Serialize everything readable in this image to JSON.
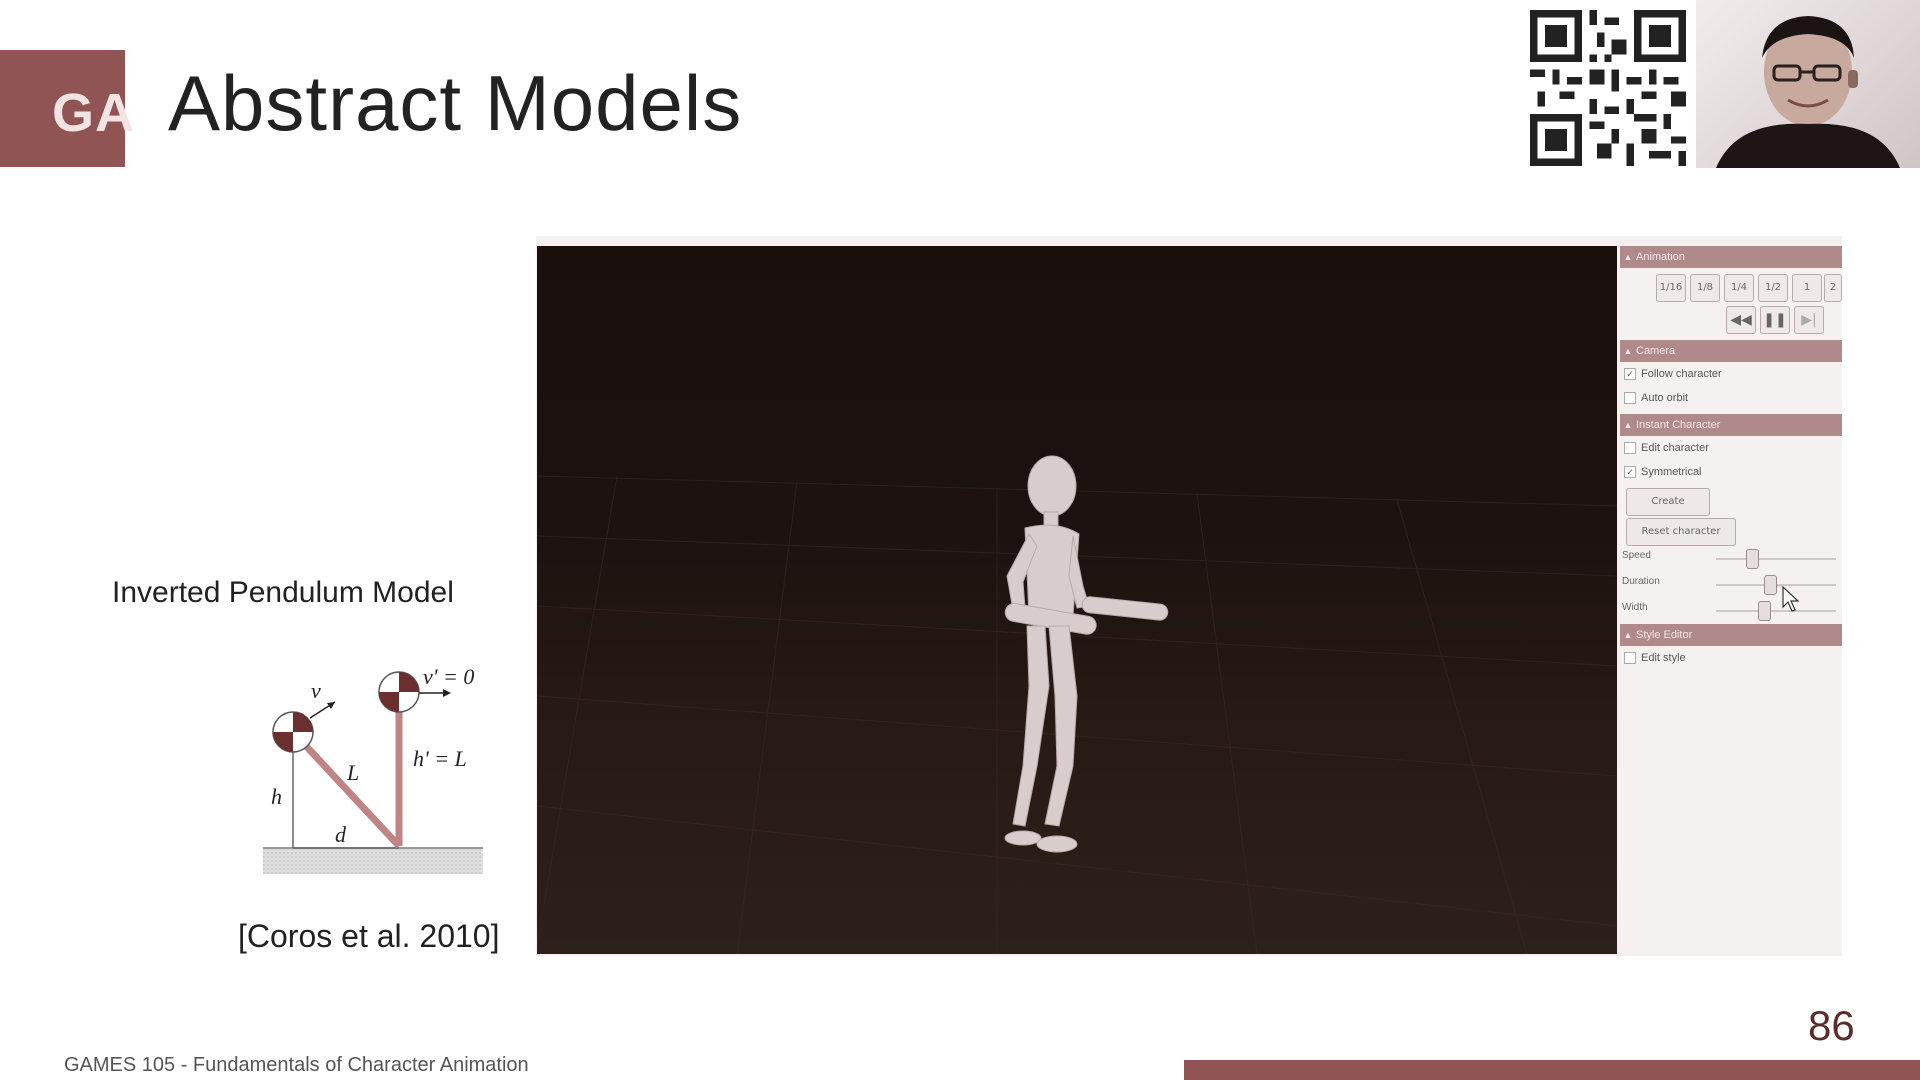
{
  "header": {
    "logo_text": "GA",
    "title": "Abstract Models"
  },
  "left": {
    "pendulum_label": "Inverted Pendulum Model",
    "figure_labels": {
      "v": "v",
      "v_prime": "v' = 0",
      "L": "L",
      "h": "h",
      "h_prime": "h' = L",
      "d": "d"
    },
    "citation": "[Coros et al. 2010]"
  },
  "app": {
    "sections": {
      "animation": "Animation",
      "camera": "Camera",
      "instant_character": "Instant Character",
      "style_editor": "Style Editor"
    },
    "speed_buttons": [
      "1/16",
      "1/8",
      "1/4",
      "1/2",
      "1",
      "2"
    ],
    "playback_icons": [
      "rewind-icon",
      "pause-icon",
      "step-icon"
    ],
    "checkboxes": {
      "follow_character": {
        "label": "Follow character",
        "checked": true
      },
      "auto_orbit": {
        "label": "Auto orbit",
        "checked": false
      },
      "edit_character": {
        "label": "Edit character",
        "checked": false
      },
      "symmetrical": {
        "label": "Symmetrical",
        "checked": true
      },
      "edit_style": {
        "label": "Edit style",
        "checked": false
      }
    },
    "buttons": {
      "create": "Create",
      "reset_character": "Reset character"
    },
    "sliders": {
      "speed": {
        "label": "Speed",
        "value": 0.3
      },
      "duration": {
        "label": "Duration",
        "value": 0.45
      },
      "width": {
        "label": "Width",
        "value": 0.4
      }
    }
  },
  "footer": {
    "course": "GAMES 105 - Fundamentals of Character Animation",
    "page_number": "86"
  },
  "colors": {
    "accent": "#8f5453",
    "viewport_bg": "#1d1210"
  }
}
